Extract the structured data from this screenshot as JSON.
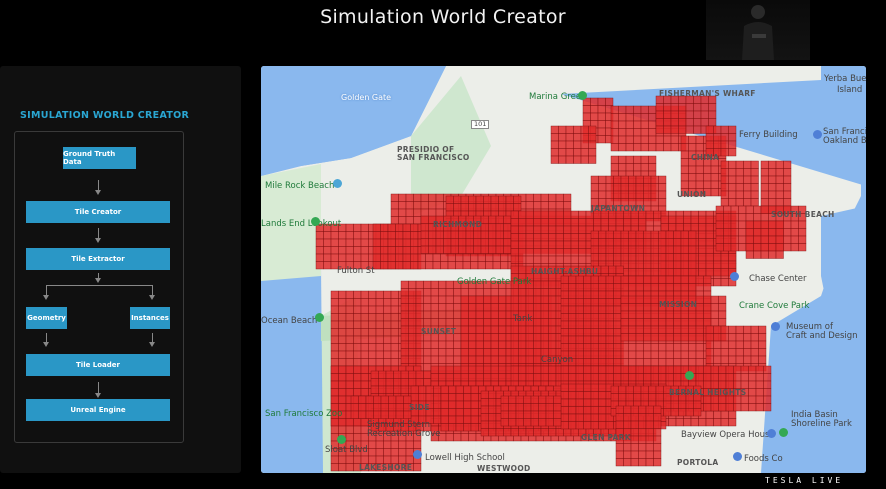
{
  "slide": {
    "title": "Simulation World Creator",
    "watermark_brand": "TESLA",
    "watermark_suffix": "LIVE"
  },
  "diagram": {
    "title": "SIMULATION WORLD CREATOR",
    "nodes": {
      "ground_truth": "Ground Truth Data",
      "tile_creator": "Tile Creator",
      "tile_extractor": "Tile Extractor",
      "geometry": "Geometry",
      "instances": "Instances",
      "tile_loader": "Tile Loader",
      "unreal_engine": "Unreal Engine"
    },
    "accent_color": "#2a97c6"
  },
  "map": {
    "labels": {
      "golden_gate": "Golden Gate",
      "marina_green": "Marina Green",
      "fishermans_wharf": "FISHERMAN'S WHARF",
      "yerba_buena": "Yerba Buena",
      "island": "Island",
      "presidio": "PRESIDIO OF\nSAN FRANCISCO",
      "ferry_building": "Ferry Building",
      "chinatown": "CHINA",
      "san_francisco": "San Francisco-\nOakland Bay",
      "mile_rock": "Mile Rock Beach",
      "union": "UNION",
      "lands_end": "Lands End Lookout",
      "japantown": "JAPANTOWN",
      "south_beach": "SOUTH BEACH",
      "richmond": "RICHMOND",
      "fulton": "Fulton St",
      "haight": "HAIGHT-ASHBU",
      "chase_center": "Chase Center",
      "gg_park": "Golden Gate Park",
      "mission": "MISSION",
      "crane_cove": "Crane Cove Park",
      "ocean_beach": "Ocean Beach",
      "museum": "Museum of\nCraft and Design",
      "tank": "Tank",
      "sunset": "SUNSET",
      "seaside": "SIDE",
      "bernal": "BERNAL HEIGHTS",
      "india_basin": "India Basin\nShoreline Park",
      "sf_zoo": "San Francisco Zoo",
      "sigmund": "Sigmund Stern\nRecreation Grove",
      "glen_park": "GLEN PARK",
      "bayview": "Bayview Opera House",
      "sloat": "Sloat Blvd",
      "lowell": "Lowell High School",
      "portola": "PORTOLA",
      "foods_co": "Foods Co",
      "lakeshore": "LAKESHORE",
      "westwood": "WESTWOOD",
      "route_101": "101",
      "ashbury_canyon": "Canyon"
    },
    "tile_color": "#e02b2b",
    "water_color": "#8ab8ee",
    "land_color": "#eceee9"
  }
}
